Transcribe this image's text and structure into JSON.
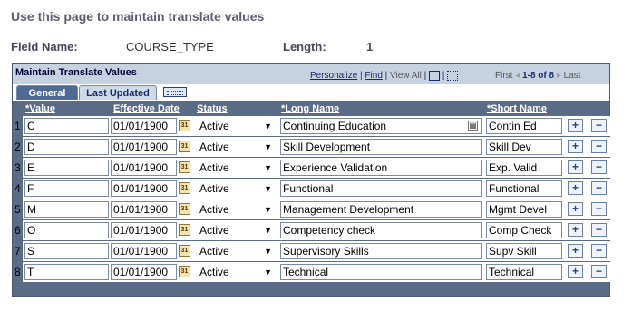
{
  "page": {
    "title": "Use this page to maintain translate values",
    "field_name_label": "Field Name:",
    "field_name_value": "COURSE_TYPE",
    "length_label": "Length:",
    "length_value": "1"
  },
  "grid": {
    "title": "Maintain Translate Values",
    "personalize": "Personalize",
    "find": "Find",
    "view_all": "View All",
    "first": "First",
    "range": "1-8 of 8",
    "last": "Last",
    "tabs": [
      "General",
      "Last Updated"
    ],
    "headers": {
      "value": "*Value",
      "effective_date": "Effective Date",
      "status": "Status",
      "long_name": "*Long Name",
      "short_name": "*Short Name"
    },
    "rows": [
      {
        "num": "1",
        "value": "C",
        "date": "01/01/1900",
        "status": "Active",
        "long": "Continuing Education",
        "short": "Contin Ed"
      },
      {
        "num": "2",
        "value": "D",
        "date": "01/01/1900",
        "status": "Active",
        "long": "Skill Development",
        "short": "Skill Dev"
      },
      {
        "num": "3",
        "value": "E",
        "date": "01/01/1900",
        "status": "Active",
        "long": "Experience Validation",
        "short": "Exp. Valid"
      },
      {
        "num": "4",
        "value": "F",
        "date": "01/01/1900",
        "status": "Active",
        "long": "Functional",
        "short": "Functional"
      },
      {
        "num": "5",
        "value": "M",
        "date": "01/01/1900",
        "status": "Active",
        "long": "Management Development",
        "short": "Mgmt Devel"
      },
      {
        "num": "6",
        "value": "O",
        "date": "01/01/1900",
        "status": "Active",
        "long": "Competency check",
        "short": "Comp Check"
      },
      {
        "num": "7",
        "value": "S",
        "date": "01/01/1900",
        "status": "Active",
        "long": "Supervisory Skills",
        "short": "Supv Skill"
      },
      {
        "num": "8",
        "value": "T",
        "date": "01/01/1900",
        "status": "Active",
        "long": "Technical",
        "short": "Technical"
      }
    ],
    "cal_glyph": "31",
    "add_glyph": "+",
    "delete_glyph": "−",
    "dropdown_glyph": "▼"
  },
  "icons": {
    "calendar": "calendar-icon",
    "add": "add-row-icon",
    "delete": "delete-row-icon",
    "dropdown": "chevron-down-icon",
    "zoom": "expand-text-icon",
    "download": "download-icon",
    "spreadsheet": "spreadsheet-icon",
    "show_all_columns": "show-all-columns-icon"
  },
  "colors": {
    "grid_frame": "#5a6b85",
    "header_band": "#c7d2e1",
    "active_tab": "#4e6a95",
    "title_text": "#5c5c70"
  }
}
